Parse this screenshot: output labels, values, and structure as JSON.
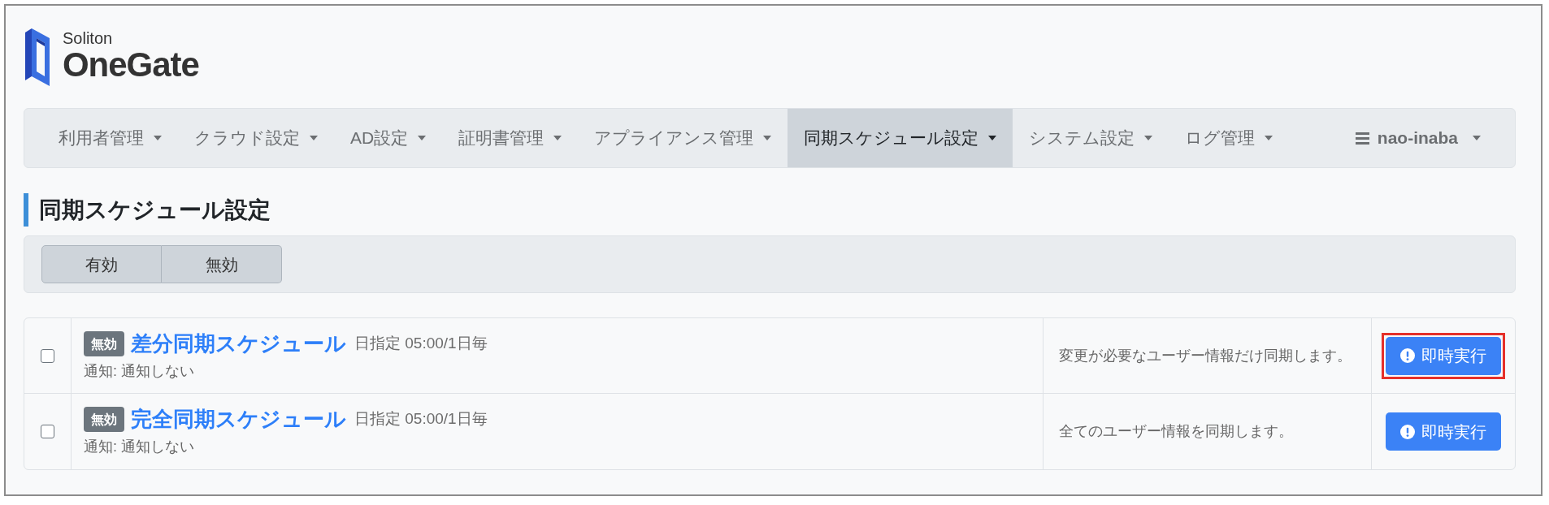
{
  "logo": {
    "brand": "Soliton",
    "product": "OneGate"
  },
  "nav": {
    "items": [
      {
        "label": "利用者管理",
        "selected": false
      },
      {
        "label": "クラウド設定",
        "selected": false
      },
      {
        "label": "AD設定",
        "selected": false
      },
      {
        "label": "証明書管理",
        "selected": false
      },
      {
        "label": "アプライアンス管理",
        "selected": false
      },
      {
        "label": "同期スケジュール設定",
        "selected": true
      },
      {
        "label": "システム設定",
        "selected": false
      },
      {
        "label": "ログ管理",
        "selected": false
      }
    ],
    "user_menu": {
      "label": "nao-inaba"
    }
  },
  "page": {
    "title": "同期スケジュール設定"
  },
  "filter": {
    "buttons": [
      {
        "label": "有効",
        "selected": false
      },
      {
        "label": "無効",
        "selected": false
      }
    ]
  },
  "schedules": [
    {
      "checked": false,
      "badge": "無効",
      "name": "差分同期スケジュール",
      "schedule": "日指定 05:00/1日毎",
      "notification": "通知: 通知しない",
      "description": "変更が必要なユーザー情報だけ同期します。",
      "action": {
        "label": "即時実行",
        "highlighted": true
      }
    },
    {
      "checked": false,
      "badge": "無効",
      "name": "完全同期スケジュール",
      "schedule": "日指定 05:00/1日毎",
      "notification": "通知: 通知しない",
      "description": "全てのユーザー情報を同期します。",
      "action": {
        "label": "即時実行",
        "highlighted": false
      }
    }
  ]
}
